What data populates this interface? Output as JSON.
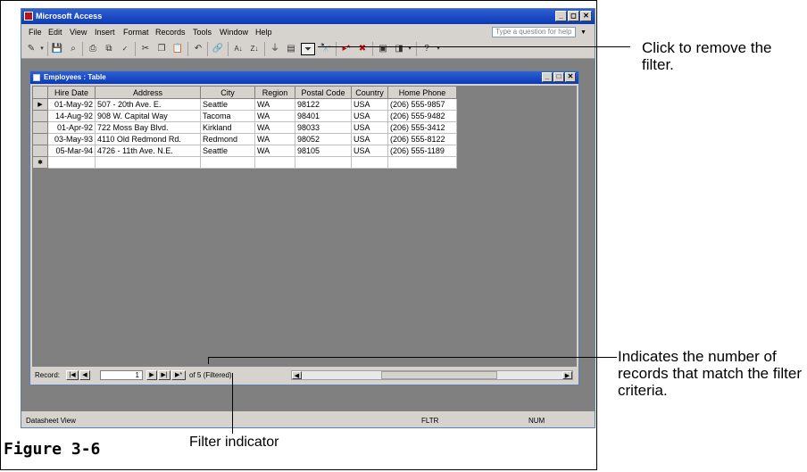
{
  "window": {
    "title": "Microsoft Access",
    "help_placeholder": "Type a question for help"
  },
  "menu": [
    "File",
    "Edit",
    "View",
    "Insert",
    "Format",
    "Records",
    "Tools",
    "Window",
    "Help"
  ],
  "table_window": {
    "title": "Employees : Table"
  },
  "columns": [
    "Hire Date",
    "Address",
    "City",
    "Region",
    "Postal Code",
    "Country",
    "Home Phone"
  ],
  "rows": [
    [
      "01-May-92",
      "507 - 20th Ave. E.",
      "Seattle",
      "WA",
      "98122",
      "USA",
      "(206) 555-9857"
    ],
    [
      "14-Aug-92",
      "908 W. Capital Way",
      "Tacoma",
      "WA",
      "98401",
      "USA",
      "(206) 555-9482"
    ],
    [
      "01-Apr-92",
      "722 Moss Bay Blvd.",
      "Kirkland",
      "WA",
      "98033",
      "USA",
      "(206) 555-3412"
    ],
    [
      "03-May-93",
      "4110 Old Redmond Rd.",
      "Redmond",
      "WA",
      "98052",
      "USA",
      "(206) 555-8122"
    ],
    [
      "05-Mar-94",
      "4726 - 11th Ave. N.E.",
      "Seattle",
      "WA",
      "98105",
      "USA",
      "(206) 555-1189"
    ]
  ],
  "current_row_marker": "▶",
  "new_row_marker": "✱",
  "navigation": {
    "record_label": "Record:",
    "current": "1",
    "of_text": "of 5 (Filtered)"
  },
  "status": {
    "view": "Datasheet View",
    "fltr": "FLTR",
    "num": "NUM"
  },
  "figure_label": "Figure 3-6",
  "callouts": {
    "remove_filter": "Click to remove the filter.",
    "record_count": "Indicates the number of records that match the filter criteria.",
    "filter_indicator": "Filter indicator"
  },
  "colors": {
    "titlebar": "#0a3ab8",
    "chrome": "#d6d3ce",
    "workspace": "#808080"
  }
}
